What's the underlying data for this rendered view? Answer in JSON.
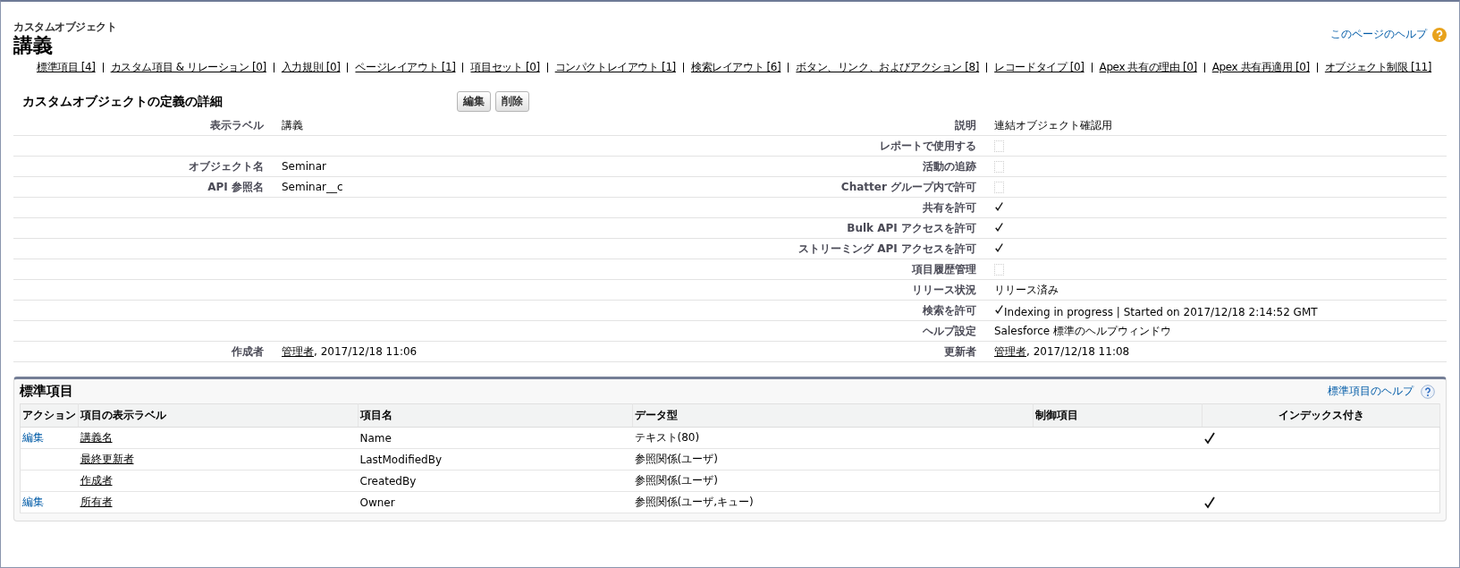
{
  "header": {
    "subtitle": "カスタムオブジェクト",
    "title": "講義",
    "help_link": "このページのヘルプ"
  },
  "nav_links": [
    "標準項目 [4]",
    "カスタム項目 & リレーション [0]",
    "入力規則 [0]",
    "ページレイアウト [1]",
    "項目セット [0]",
    "コンパクトレイアウト [1]",
    "検索レイアウト [6]",
    "ボタン、リンク、およびアクション [8]",
    "レコードタイプ [0]",
    "Apex 共有の理由 [0]",
    "Apex 共有再適用 [0]",
    "オブジェクト制限 [11]"
  ],
  "detail": {
    "title": "カスタムオブジェクトの定義の詳細",
    "buttons": [
      "編集",
      "削除"
    ],
    "rows": [
      {
        "left": {
          "kind": "text",
          "label": "表示ラベル",
          "value": "講義"
        },
        "right": {
          "kind": "text",
          "label": "説明",
          "value": "連結オブジェクト確認用"
        }
      },
      {
        "right": {
          "kind": "checkbox",
          "label": "レポートで使用する",
          "checked": false
        }
      },
      {
        "left": {
          "kind": "text",
          "label": "オブジェクト名",
          "value": "Seminar"
        },
        "right": {
          "kind": "checkbox",
          "label": "活動の追跡",
          "checked": false
        }
      },
      {
        "left": {
          "kind": "text",
          "label": "API 参照名",
          "value": "Seminar__c"
        },
        "right": {
          "kind": "checkbox",
          "label": "Chatter グループ内で許可",
          "checked": false
        }
      },
      {
        "right": {
          "kind": "checkbox",
          "label": "共有を許可",
          "checked": true
        }
      },
      {
        "right": {
          "kind": "checkbox",
          "label": "Bulk API アクセスを許可",
          "checked": true
        }
      },
      {
        "right": {
          "kind": "checkbox",
          "label": "ストリーミング API アクセスを許可",
          "checked": true
        }
      },
      {
        "right": {
          "kind": "checkbox",
          "label": "項目履歴管理",
          "checked": false
        }
      },
      {
        "right": {
          "kind": "text",
          "label": "リリース状況",
          "value": "リリース済み"
        }
      },
      {
        "right": {
          "kind": "checkbox",
          "label": "検索を許可",
          "checked": true,
          "value": "Indexing in progress | Started on 2017/12/18 2:14:52 GMT"
        }
      },
      {
        "right": {
          "kind": "text",
          "label": "ヘルプ設定",
          "value": "Salesforce 標準のヘルプウィンドウ"
        }
      },
      {
        "left": {
          "kind": "link",
          "label": "作成者",
          "link": "管理者",
          "value": ", 2017/12/18 11:06"
        },
        "right": {
          "kind": "link",
          "label": "更新者",
          "link": "管理者",
          "value": ", 2017/12/18 11:08"
        }
      }
    ]
  },
  "standard_fields": {
    "title": "標準項目",
    "help_link": "標準項目のヘルプ",
    "columns": [
      "アクション",
      "項目の表示ラベル",
      "項目名",
      "データ型",
      "制御項目",
      "インデックス付き"
    ],
    "rows": [
      {
        "action": "編集",
        "label": "講義名",
        "name": "Name",
        "type": "テキスト(80)",
        "indexed": true
      },
      {
        "label": "最終更新者",
        "name": "LastModifiedBy",
        "type": "参照関係(ユーザ)",
        "indexed": false
      },
      {
        "label": "作成者",
        "name": "CreatedBy",
        "type": "参照関係(ユーザ)",
        "indexed": false
      },
      {
        "action": "編集",
        "label": "所有者",
        "name": "Owner",
        "type": "参照関係(ユーザ,キュー)",
        "indexed": true
      }
    ]
  }
}
